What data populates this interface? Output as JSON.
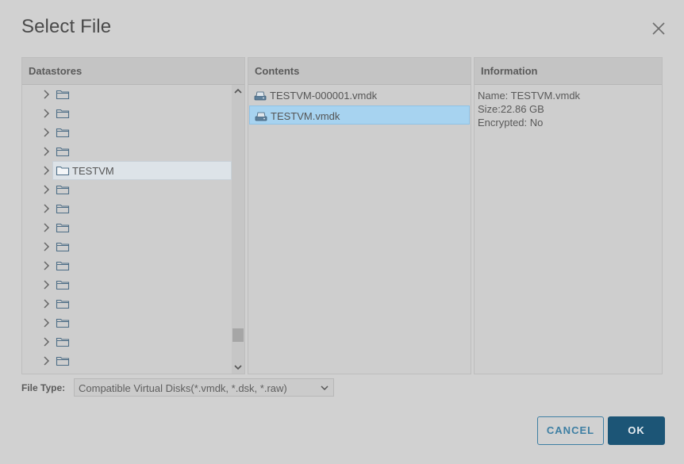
{
  "dialog": {
    "title": "Select File"
  },
  "panes": {
    "datastores": {
      "header": "Datastores"
    },
    "contents": {
      "header": "Contents"
    },
    "information": {
      "header": "Information"
    }
  },
  "datastores": {
    "items": [
      {
        "label": "",
        "selected": false
      },
      {
        "label": "",
        "selected": false
      },
      {
        "label": "",
        "selected": false
      },
      {
        "label": "",
        "selected": false
      },
      {
        "label": "TESTVM",
        "selected": true
      },
      {
        "label": "",
        "selected": false
      },
      {
        "label": "",
        "selected": false
      },
      {
        "label": "",
        "selected": false
      },
      {
        "label": "",
        "selected": false
      },
      {
        "label": "",
        "selected": false
      },
      {
        "label": "",
        "selected": false
      },
      {
        "label": "",
        "selected": false
      },
      {
        "label": "",
        "selected": false
      },
      {
        "label": "",
        "selected": false
      },
      {
        "label": "",
        "selected": false
      }
    ]
  },
  "contents": {
    "files": [
      {
        "name": "TESTVM-000001.vmdk",
        "selected": false,
        "icon": "virtual-disk-icon"
      },
      {
        "name": "TESTVM.vmdk",
        "selected": true,
        "icon": "virtual-disk-icon"
      }
    ]
  },
  "information": {
    "name_line": "Name: TESTVM.vmdk",
    "size_line": "Size:22.86 GB",
    "encrypted_line": "Encrypted: No"
  },
  "file_type": {
    "label": "File Type:",
    "selected": "Compatible Virtual Disks(*.vmdk, *.dsk, *.raw)"
  },
  "buttons": {
    "cancel": "CANCEL",
    "ok": "OK"
  },
  "colors": {
    "selection": "#a7d3f0",
    "tree_selection": "#dde3e8",
    "primary": "#1c5576",
    "secondary": "#3e7fa3"
  }
}
